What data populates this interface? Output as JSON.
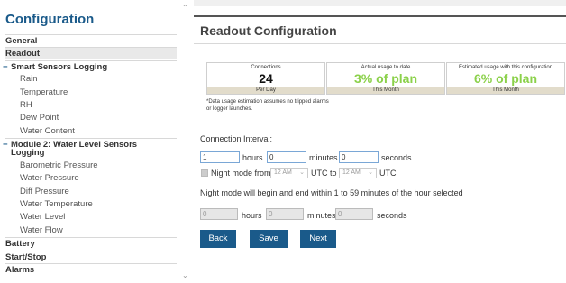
{
  "sidebar": {
    "title": "Configuration",
    "items": [
      {
        "label": "General"
      },
      {
        "label": "Readout"
      },
      {
        "label": "Smart Sensors Logging"
      },
      {
        "label": "Rain"
      },
      {
        "label": "Temperature"
      },
      {
        "label": "RH"
      },
      {
        "label": "Dew Point"
      },
      {
        "label": "Water Content"
      },
      {
        "label": "Module 2: Water Level Sensors"
      },
      {
        "label": "Logging"
      },
      {
        "label": "Barometric Pressure"
      },
      {
        "label": "Water Pressure"
      },
      {
        "label": "Diff Pressure"
      },
      {
        "label": "Water Temperature"
      },
      {
        "label": "Water Level"
      },
      {
        "label": "Water Flow"
      },
      {
        "label": "Battery"
      },
      {
        "label": "Start/Stop"
      },
      {
        "label": "Alarms"
      }
    ]
  },
  "main": {
    "title": "Readout Configuration",
    "cards": [
      {
        "caption": "Connections",
        "value": "24",
        "foot": "Per Day"
      },
      {
        "caption": "Actual usage to date",
        "value": "3% of plan",
        "foot": "This Month"
      },
      {
        "caption": "Estimated usage with this configuration",
        "value": "6% of plan",
        "foot": "This Month"
      }
    ],
    "note": "*Data usage estimation assumes no tripped alarms or logger launches.",
    "interval_label": "Connection Interval:",
    "interval": {
      "hours_value": "1",
      "hours_label": "hours",
      "minutes_value": "0",
      "minutes_label": "minutes",
      "seconds_value": "0",
      "seconds_label": "seconds"
    },
    "night_mode": {
      "label": "Night mode from",
      "from": "12 AM",
      "utc_to": "UTC to",
      "to": "12 AM",
      "utc": "UTC",
      "info": "Night mode will begin and end within 1 to 59 minutes of the hour selected"
    },
    "night_interval": {
      "hours_value": "0",
      "hours_label": "hours",
      "minutes_value": "0",
      "minutes_label": "minutes",
      "seconds_value": "0",
      "seconds_label": "seconds"
    },
    "buttons": {
      "back": "Back",
      "save": "Save",
      "next": "Next"
    }
  },
  "colors": {
    "brand": "#1a5a8a",
    "usage_green": "#8bd14a",
    "card_footer": "#e2dccb"
  },
  "icons": {
    "scroll_up": "chevron-up-icon",
    "scroll_down": "chevron-down-icon",
    "select_arrow": "chevron-down-icon"
  }
}
